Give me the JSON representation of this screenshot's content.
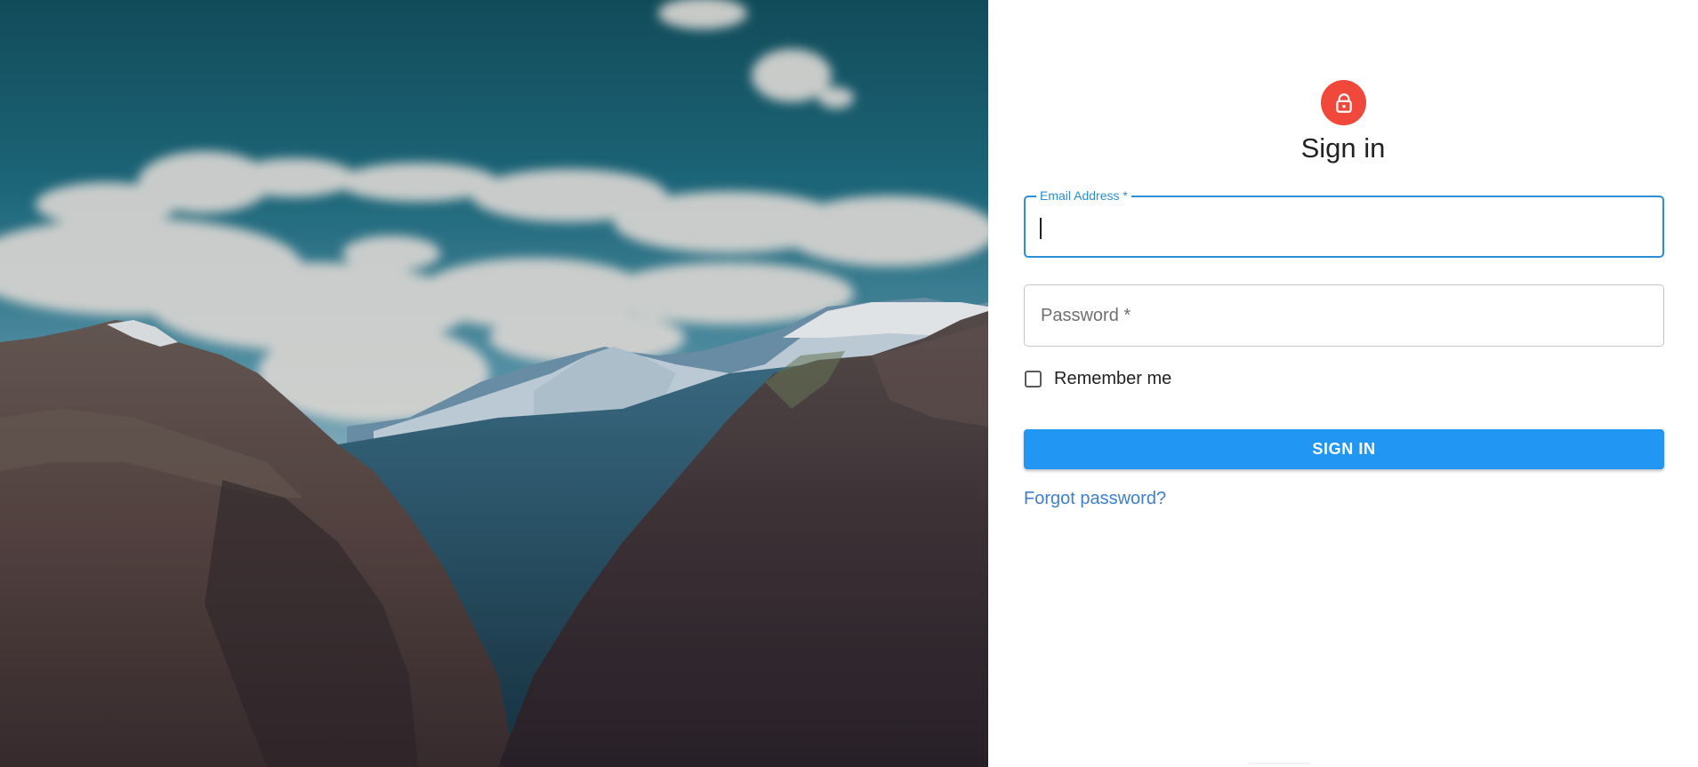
{
  "hero": {
    "description_icon": "mountain-landscape-image"
  },
  "form": {
    "icon": "lock-icon",
    "accent_color": "#f0483a",
    "title": "Sign in",
    "email": {
      "label": "Email Address *",
      "value": "",
      "focused": true
    },
    "password": {
      "placeholder": "Password *",
      "value": ""
    },
    "remember": {
      "label": "Remember me",
      "checked": false
    },
    "submit_label": "SIGN IN",
    "submit_color": "#2196f3",
    "forgot_label": "Forgot password?",
    "link_color": "#3f7fc9",
    "focus_color": "#2a8fd6"
  }
}
